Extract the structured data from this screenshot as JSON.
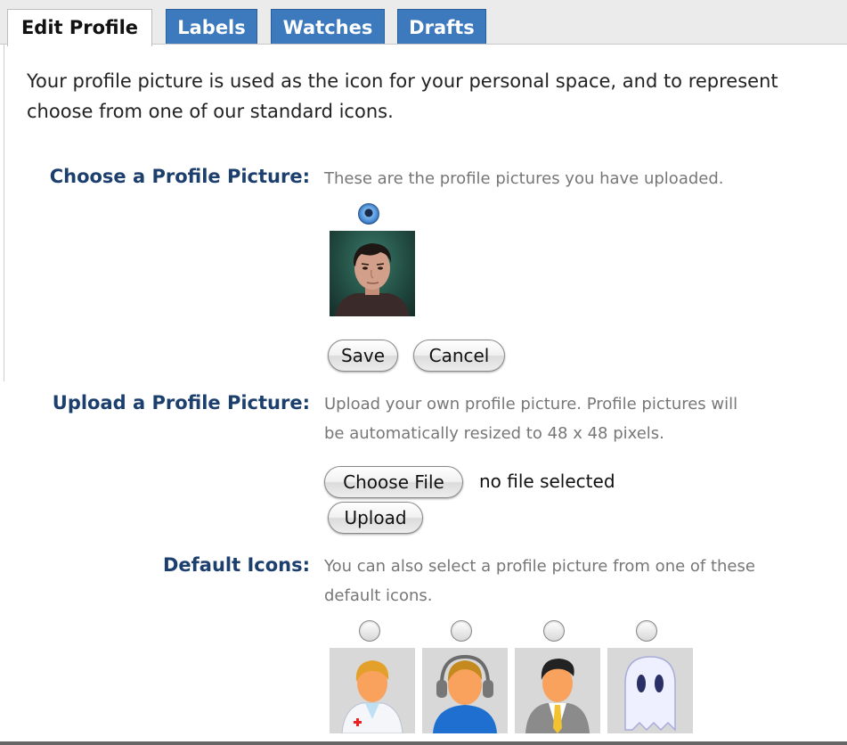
{
  "tabs": [
    {
      "label": "Edit Profile",
      "active": true
    },
    {
      "label": "Labels",
      "active": false
    },
    {
      "label": "Watches",
      "active": false
    },
    {
      "label": "Drafts",
      "active": false
    }
  ],
  "intro": {
    "line1": "Your profile picture is used as the icon for your personal space, and to represent",
    "line2": "choose from one of our standard icons."
  },
  "choose": {
    "label": "Choose a Profile Picture:",
    "description": "These are the profile pictures you have uploaded.",
    "selected": true,
    "save_label": "Save",
    "cancel_label": "Cancel"
  },
  "upload": {
    "label": "Upload a Profile Picture:",
    "description_line1": "Upload your own profile picture. Profile pictures will",
    "description_line2": "be automatically resized to 48 x 48 pixels.",
    "choose_file_label": "Choose File",
    "file_status": "no file selected",
    "upload_label": "Upload"
  },
  "defaults": {
    "label": "Default Icons:",
    "description_line1": "You can also select a profile picture from one of these",
    "description_line2": "default icons.",
    "icons": [
      {
        "name": "doctor-icon",
        "selected": false
      },
      {
        "name": "headset-user-icon",
        "selected": false
      },
      {
        "name": "businessman-icon",
        "selected": false
      },
      {
        "name": "ghost-icon",
        "selected": false
      }
    ]
  },
  "colors": {
    "tab_blue": "#3d79bd",
    "label_blue": "#1c3f6e",
    "description_gray": "#777777"
  }
}
